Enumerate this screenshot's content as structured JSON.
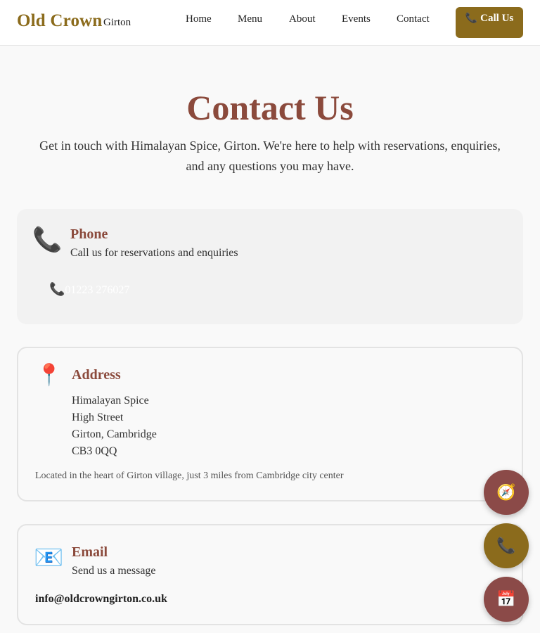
{
  "header": {
    "brand_name": "Old Crown",
    "brand_sub": "Girton",
    "nav": {
      "home": "Home",
      "menu": "Menu",
      "about": "About",
      "events": "Events",
      "contact": "Contact"
    },
    "call_button": "Call Us",
    "call_icon": "📞"
  },
  "hero": {
    "title": "Contact Us",
    "intro": "Get in touch with Himalayan Spice, Girton. We're here to help with reservations, enquiries, and any questions you may have."
  },
  "phone_card": {
    "icon": "📞",
    "title": "Phone",
    "subtitle": "Call us for reservations and enquiries",
    "number_icon": "📞",
    "number": "01223 276027"
  },
  "address_card": {
    "icon": "📍",
    "title": "Address",
    "lines": [
      "Himalayan Spice",
      "High Street",
      "Girton, Cambridge",
      "CB3 0QQ"
    ],
    "note": "Located in the heart of Girton village, just 3 miles from Cambridge city center"
  },
  "email_card": {
    "icon": "📧",
    "title": "Email",
    "subtitle": "Send us a message",
    "address": "info@oldcrowngirton.co.uk"
  },
  "fabs": {
    "directions_icon": "🧭",
    "call_icon": "📞",
    "book_icon": "📅"
  },
  "colors": {
    "gold": "#8b6b1c",
    "maroon": "#8b4a3c",
    "fab_maroon": "#8b4a48"
  }
}
